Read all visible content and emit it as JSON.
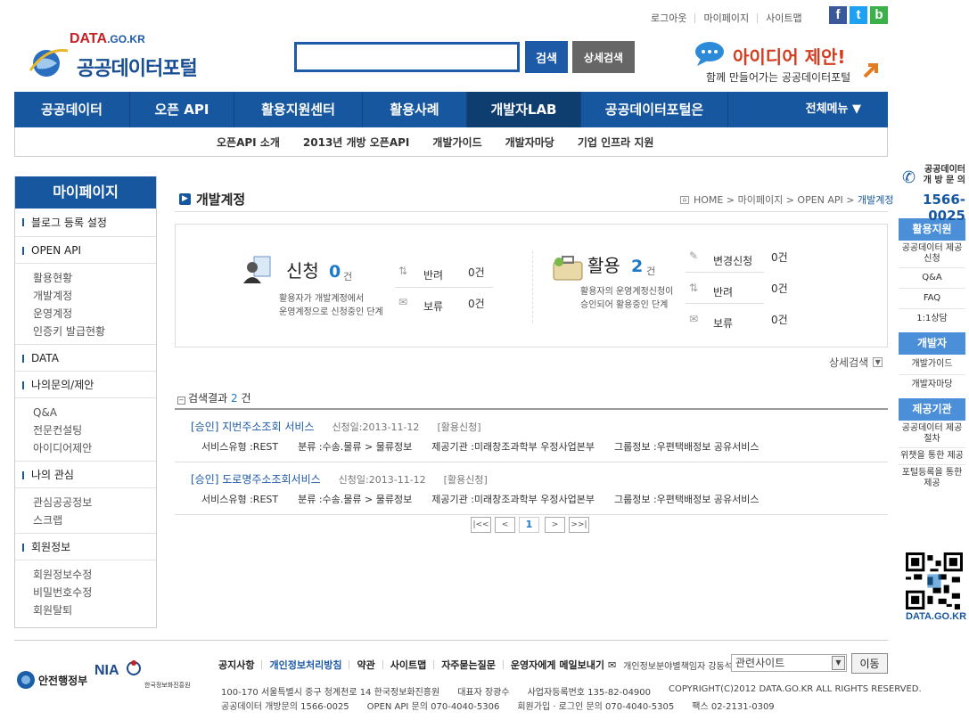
{
  "top_links": [
    "로그아웃",
    "마이페이지",
    "사이트맵"
  ],
  "sns": [
    "f",
    "t",
    "b"
  ],
  "logo": {
    "domain": "DATA",
    "domain_sub": ".GO.KR",
    "name": "공공데이터포털"
  },
  "search": {
    "value": "",
    "button": "검색",
    "advanced_button": "상세검색"
  },
  "idea_banner": {
    "line1": "아이디어 제안!",
    "line2": "함께 만들어가는 공공데이터포털"
  },
  "gnb": {
    "items": [
      "공공데이터",
      "오픈 API",
      "활용지원센터",
      "활용사례",
      "개발자LAB",
      "공공데이터포털은"
    ],
    "active_index": 4,
    "all_menu": "전체메뉴"
  },
  "subnav": [
    "오픈API 소개",
    "2013년 개방 오픈API",
    "개발가이드",
    "개발자마당",
    "기업 인프라 지원"
  ],
  "lnb": {
    "title": "마이페이지",
    "blog": "블로그 등록 설정",
    "openapi": "OPEN API",
    "openapi_items": [
      "활용현황",
      "개발계정",
      "운영계정",
      "인증키 발급현황"
    ],
    "data": "DATA",
    "inquiry": "나의문의/제안",
    "inquiry_items": [
      "Q&A",
      "전문컨설팅",
      "아이디어제안"
    ],
    "interest": "나의 관심",
    "interest_items": [
      "관심공공정보",
      "스크랩"
    ],
    "member": "회원정보",
    "member_items": [
      "회원정보수정",
      "비밀번호수정",
      "회원탈퇴"
    ]
  },
  "page": {
    "title": "개발계정",
    "breadcrumb": {
      "home": "HOME",
      "sep": ">",
      "b1": "마이페이지",
      "b2": "OPEN API",
      "current": "개발계정"
    }
  },
  "summary": {
    "apply": {
      "label": "신청",
      "count": "0",
      "unit": "건",
      "desc1": "활용자가 개발계정에서",
      "desc2": "운영계정으로 신청중인 단계"
    },
    "apply_status": [
      {
        "label": "반려",
        "value": "0건"
      },
      {
        "label": "보류",
        "value": "0건"
      }
    ],
    "use": {
      "label": "활용",
      "count": "2",
      "unit": "건",
      "desc1": "활용자의 운영계정신청이",
      "desc2": "승인되어 활용중인 단계"
    },
    "use_status": [
      {
        "label": "변경신청",
        "value": "0건"
      },
      {
        "label": "반려",
        "value": "0건"
      },
      {
        "label": "보류",
        "value": "0건"
      }
    ]
  },
  "advanced_toggle": "상세검색",
  "result": {
    "label": "검색결과",
    "count": "2",
    "unit": "건"
  },
  "rows": [
    {
      "title": "[승인] 지번주소조회 서비스",
      "date": "신청일:2013-11-12",
      "type": "[활용신청]",
      "service_type": "서비스유형 :REST",
      "category": "분류 :수송.물류 > 물류정보",
      "provider": "제공기관 :미래창조과학부 우정사업본부",
      "group": "그룹정보 :우편택배정보 공유서비스"
    },
    {
      "title": "[승인] 도로명주소조회서비스",
      "date": "신청일:2013-11-12",
      "type": "[활용신청]",
      "service_type": "서비스유형 :REST",
      "category": "분류 :수송.물류 > 물류정보",
      "provider": "제공기관 :미래창조과학부 우정사업본부",
      "group": "그룹정보 :우편택배정보 공유서비스"
    }
  ],
  "pager": {
    "first": "|<<",
    "prev": "<",
    "current": "1",
    "next": ">",
    "last": ">>|"
  },
  "quick": {
    "phone_label1": "공공데이터",
    "phone_label2": "개 방 문 의",
    "phone": "1566-0025",
    "support": "활용지원",
    "support_items": [
      "공공데이터 제공신청",
      "Q&A",
      "FAQ",
      "1:1상담"
    ],
    "dev": "개발자",
    "dev_items": [
      "개발가이드",
      "개발자마당"
    ],
    "provider": "제공기관",
    "provider_items": [
      "공공데이터 제공절차",
      "위챗을 통한 제공",
      "포털등록을 통한 제공"
    ],
    "qr_text": "DATA.GO.KR"
  },
  "footer": {
    "gov": "안전행정부",
    "nia": "NIA",
    "nia_sub": "한국정보화진흥원",
    "links": [
      "공지사항",
      "개인정보처리방침",
      "약관",
      "사이트맵",
      "자주묻는질문",
      "운영자에게 메일보내기"
    ],
    "privacy_officer": "개인정보분야별책임자 강동석",
    "related": "관련사이트",
    "go": "이동",
    "addr1": [
      "100-170  서울특별시 중구 청계천로 14 한국정보화진흥원",
      "대표자 장광수",
      "사업자등록번호 135-82-04900",
      "COPYRIGHT(C)2012 DATA.GO.KR ALL RIGHTS RESERVED."
    ],
    "addr2": [
      "공공데이터 개방문의 1566-0025",
      "OPEN API 문의 070-4040-5306",
      "회원가입 · 로그인 문의 070-4040-5305",
      "팩스 02-2131-0309"
    ]
  },
  "colors": {
    "primary": "#17579f",
    "accent": "#1d7ac9",
    "sns_facebook": "#3b5998",
    "sns_twitter": "#1da1f2",
    "sns_blog": "#3cb04a"
  }
}
